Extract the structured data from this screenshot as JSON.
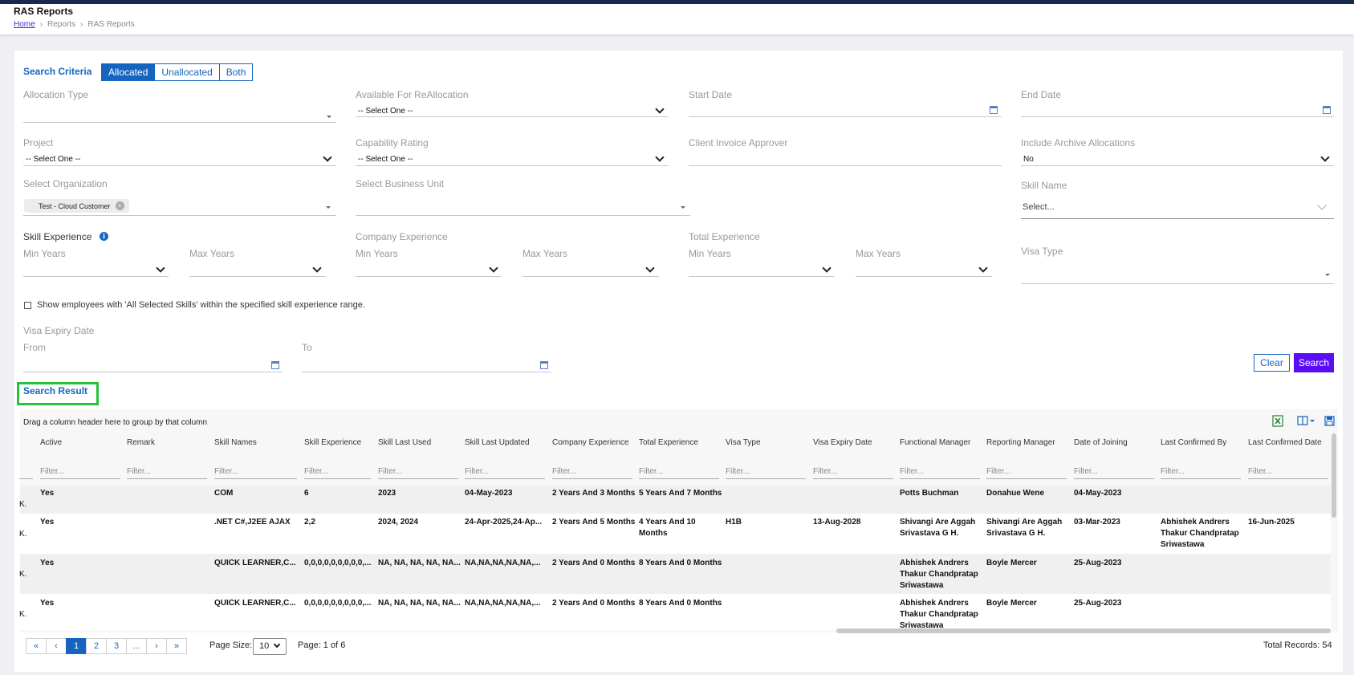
{
  "header": {
    "title": "RAS Reports",
    "breadcrumb": {
      "home": "Home",
      "sep": "›",
      "reports": "Reports",
      "current": "RAS Reports"
    }
  },
  "search_criteria": {
    "title": "Search Criteria",
    "modes": [
      "Allocated",
      "Unallocated",
      "Both"
    ],
    "active_mode": "Allocated",
    "fields": {
      "allocation_type": {
        "label": "Allocation Type",
        "value": ""
      },
      "available_realloc": {
        "label": "Available For ReAllocation",
        "value": "-- Select One --"
      },
      "start_date": {
        "label": "Start Date",
        "value": ""
      },
      "end_date": {
        "label": "End Date",
        "value": ""
      },
      "project": {
        "label": "Project",
        "value": "-- Select One --"
      },
      "capability_rating": {
        "label": "Capability Rating",
        "value": "-- Select One --"
      },
      "client_invoice_approver": {
        "label": "Client Invoice Approver",
        "value": ""
      },
      "include_archive": {
        "label": "Include Archive Allocations",
        "value": "No"
      },
      "select_org": {
        "label": "Select Organization",
        "chip": "Test - Cloud Customer"
      },
      "select_bu": {
        "label": "Select Business Unit",
        "value": ""
      },
      "skill_name": {
        "label": "Skill Name",
        "placeholder": "Select..."
      },
      "skill_experience": {
        "label": "Skill Experience",
        "min": "Min Years",
        "max": "Max Years"
      },
      "company_experience": {
        "label": "Company Experience",
        "min": "Min Years",
        "max": "Max Years"
      },
      "total_experience": {
        "label": "Total Experience",
        "min": "Min Years",
        "max": "Max Years"
      },
      "visa_type": {
        "label": "Visa Type",
        "value": ""
      },
      "all_skills_checkbox": {
        "label": "Show employees with 'All Selected Skills' within the specified skill experience range.",
        "checked": false
      },
      "visa_expiry": {
        "label": "Visa Expiry Date",
        "from": "From",
        "to": "To"
      }
    },
    "buttons": {
      "clear": "Clear",
      "search": "Search"
    }
  },
  "search_result": {
    "title": "Search Result",
    "group_hint": "Drag a column header here to group by that column",
    "filter_placeholder": "Filter...",
    "columns": [
      "Active",
      "Remark",
      "Skill Names",
      "Skill Experience",
      "Skill Last Used",
      "Skill Last Updated",
      "Company Experience",
      "Total Experience",
      "Visa Type",
      "Visa Expiry Date",
      "Functional Manager",
      "Reporting Manager",
      "Date of Joining",
      "Last Confirmed By",
      "Last Confirmed Date"
    ],
    "rows": [
      {
        "lead": "K.",
        "cells": [
          "Yes",
          "",
          "COM",
          "6",
          "2023",
          "04-May-2023",
          "2 Years And 3 Months",
          "5 Years And 7 Months",
          "",
          "",
          "Potts Buchman",
          "Donahue Wene",
          "04-May-2023",
          "",
          ""
        ]
      },
      {
        "lead": "K.",
        "cells": [
          "Yes",
          "",
          ".NET C#,J2EE AJAX",
          "2,2",
          "2024, 2024",
          "24-Apr-2025,24-Ap...",
          "2 Years And 5 Months",
          "4 Years And 10 Months",
          "H1B",
          "13-Aug-2028",
          "Shivangi Are Aggah Srivastava G H.",
          "Shivangi Are Aggah Srivastava G H.",
          "03-Mar-2023",
          "Abhishek Andrers Thakur Chandpratap Sriwastawa",
          "16-Jun-2025"
        ]
      },
      {
        "lead": "K.",
        "cells": [
          "Yes",
          "",
          "QUICK LEARNER,C...",
          "0,0,0,0,0,0,0,0,0,...",
          "NA, NA, NA, NA, NA...",
          "NA,NA,NA,NA,NA,...",
          "2 Years And 0 Months",
          "8 Years And 0 Months",
          "",
          "",
          "Abhishek Andrers Thakur Chandpratap Sriwastawa",
          "Boyle Mercer",
          "25-Aug-2023",
          "",
          ""
        ]
      },
      {
        "lead": "K.",
        "cells": [
          "Yes",
          "",
          "QUICK LEARNER,C...",
          "0,0,0,0,0,0,0,0,0,...",
          "NA, NA, NA, NA, NA...",
          "NA,NA,NA,NA,NA,...",
          "2 Years And 0 Months",
          "8 Years And 0 Months",
          "",
          "",
          "Abhishek Andrers Thakur Chandpratap Sriwastawa",
          "Boyle Mercer",
          "25-Aug-2023",
          "",
          ""
        ]
      }
    ],
    "pager": {
      "first": "«",
      "prev": "‹",
      "pages": [
        "1",
        "2",
        "3",
        "..."
      ],
      "current": "1",
      "next": "›",
      "last": "»"
    },
    "page_size_label": "Page Size:",
    "page_size": "10",
    "page_info": "Page: 1 of 6",
    "total_records": "Total Records: 54"
  }
}
